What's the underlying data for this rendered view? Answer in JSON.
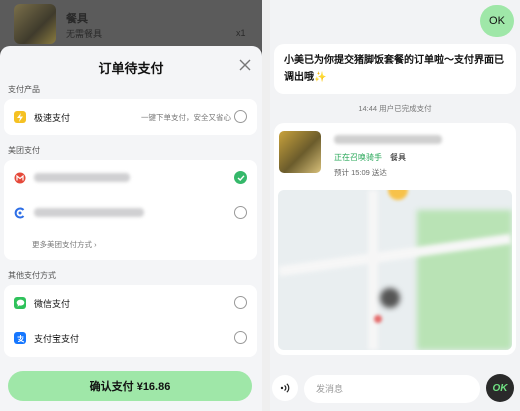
{
  "background_order": {
    "title": "餐具",
    "subtitle": "无需餐具",
    "qty": "x1"
  },
  "sheet": {
    "title": "订单待支付",
    "section_product": "支付产品",
    "express": {
      "label": "极速支付",
      "hint": "一键下单支付，安全又省心"
    },
    "section_meituan": "美团支付",
    "more_meituan": "更多美团支付方式 ›",
    "section_other": "其他支付方式",
    "wechat": {
      "label": "微信支付"
    },
    "alipay": {
      "label": "支付宝支付"
    },
    "confirm_button": "确认支付 ¥16.86"
  },
  "chat": {
    "ok_bubble": "OK",
    "message": "小美已为你提交猪脚饭套餐的订单啦～支付界面已调出哦✨",
    "system_note": "14:44 用户已完成支付",
    "order_card": {
      "status": "正在召唤骑手",
      "tag": "餐具",
      "eta": "预计 15:09 送达"
    },
    "input_placeholder": "发消息",
    "ok_button": "OK"
  },
  "colors": {
    "accent_green": "#9fe7a8",
    "status_green": "#2aa85a",
    "checked_green": "#35b86a"
  }
}
